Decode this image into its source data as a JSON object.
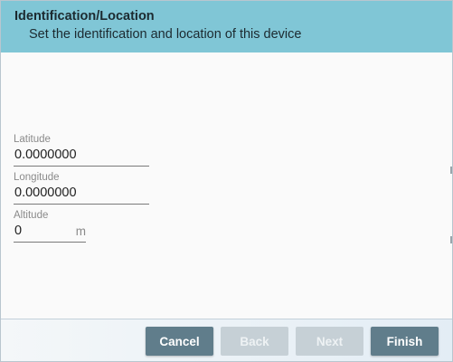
{
  "header": {
    "title": "Identification/Location",
    "subtitle": "Set the identification and location of this device"
  },
  "fields": {
    "latitude": {
      "label": "Latitude",
      "value": "0.0000000"
    },
    "longitude": {
      "label": "Longitude",
      "value": "0.0000000"
    },
    "altitude": {
      "label": "Altitude",
      "value": "0",
      "unit": "m"
    }
  },
  "footer": {
    "cancel_label": "Cancel",
    "back_label": "Back",
    "next_label": "Next",
    "finish_label": "Finish"
  },
  "colors": {
    "header_bg": "#80c6d6",
    "button_bg": "#607d8b",
    "button_disabled_bg": "#c6d0d6"
  }
}
